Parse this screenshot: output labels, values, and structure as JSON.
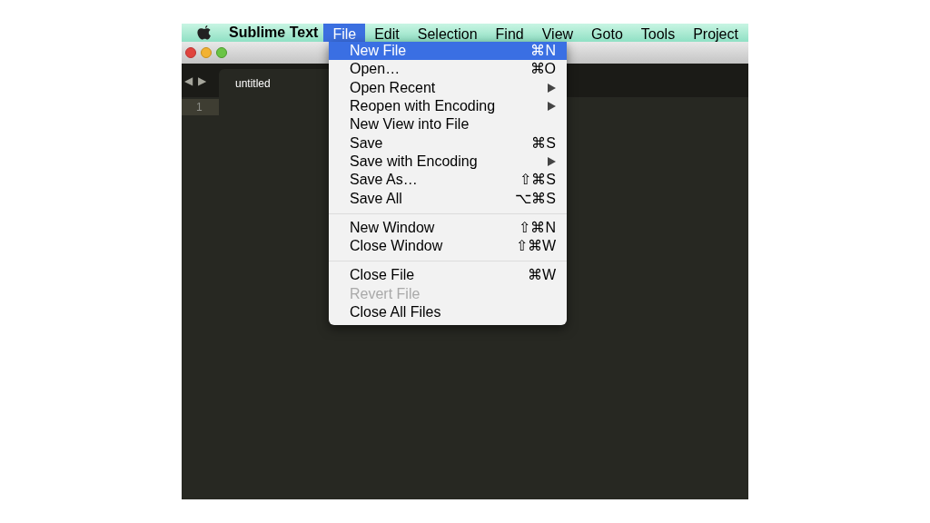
{
  "menu_bar": {
    "app_name": "Sublime Text",
    "menus": [
      {
        "label": "File",
        "selected": true
      },
      {
        "label": "Edit",
        "selected": false
      },
      {
        "label": "Selection",
        "selected": false
      },
      {
        "label": "Find",
        "selected": false
      },
      {
        "label": "View",
        "selected": false
      },
      {
        "label": "Goto",
        "selected": false
      },
      {
        "label": "Tools",
        "selected": false
      },
      {
        "label": "Project",
        "selected": false
      }
    ]
  },
  "tab_bar": {
    "nav_back": "◀",
    "nav_forward": "▶",
    "tabs": [
      {
        "label": "untitled",
        "selected": true
      }
    ]
  },
  "editor": {
    "line_numbers": [
      "1"
    ]
  },
  "file_menu": {
    "sections": [
      {
        "items": [
          {
            "label": "New File",
            "shortcut": "⌘N",
            "submenu": false,
            "disabled": false,
            "selected": true
          },
          {
            "label": "Open…",
            "shortcut": "⌘O",
            "submenu": false,
            "disabled": false,
            "selected": false
          },
          {
            "label": "Open Recent",
            "submenu": true,
            "disabled": false,
            "selected": false
          },
          {
            "label": "Reopen with Encoding",
            "submenu": true,
            "disabled": false,
            "selected": false
          },
          {
            "label": "New View into File",
            "submenu": false,
            "disabled": false,
            "selected": false
          },
          {
            "label": "Save",
            "shortcut": "⌘S",
            "submenu": false,
            "disabled": false,
            "selected": false
          },
          {
            "label": "Save with Encoding",
            "submenu": true,
            "disabled": false,
            "selected": false
          },
          {
            "label": "Save As…",
            "shortcut": "⇧⌘S",
            "submenu": false,
            "disabled": false,
            "selected": false
          },
          {
            "label": "Save All",
            "shortcut": "⌥⌘S",
            "submenu": false,
            "disabled": false,
            "selected": false
          }
        ]
      },
      {
        "items": [
          {
            "label": "New Window",
            "shortcut": "⇧⌘N",
            "submenu": false,
            "disabled": false,
            "selected": false
          },
          {
            "label": "Close Window",
            "shortcut": "⇧⌘W",
            "submenu": false,
            "disabled": false,
            "selected": false
          }
        ]
      },
      {
        "items": [
          {
            "label": "Close File",
            "shortcut": "⌘W",
            "submenu": false,
            "disabled": false,
            "selected": false
          },
          {
            "label": "Revert File",
            "submenu": false,
            "disabled": true,
            "selected": false
          },
          {
            "label": "Close All Files",
            "submenu": false,
            "disabled": false,
            "selected": false
          }
        ]
      }
    ]
  }
}
